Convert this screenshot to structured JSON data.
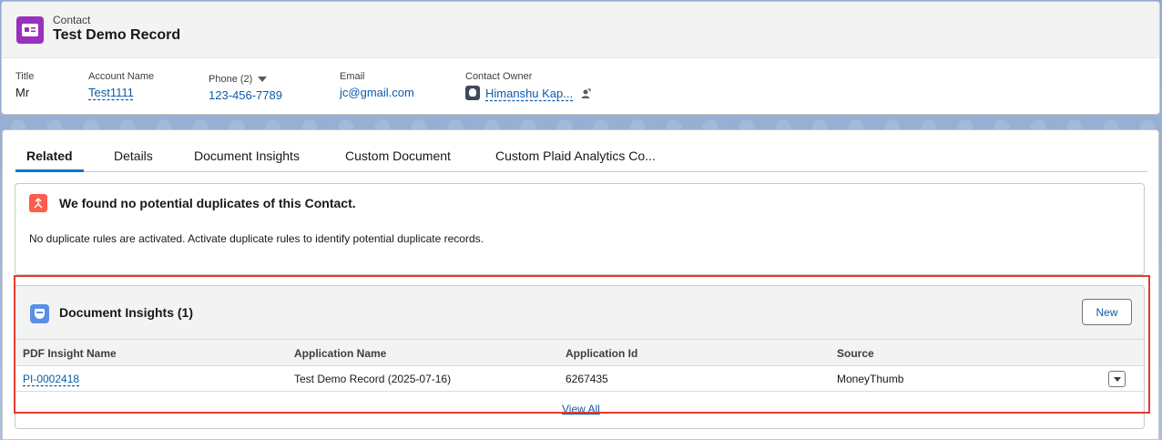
{
  "header": {
    "object_label": "Contact",
    "record_title": "Test Demo Record",
    "icon": "contact-card-icon"
  },
  "highlights": {
    "title": {
      "label": "Title",
      "value": "Mr"
    },
    "account_name": {
      "label": "Account Name",
      "value": "Test1111"
    },
    "phone": {
      "label": "Phone (2)",
      "value": "123-456-7789"
    },
    "email": {
      "label": "Email",
      "value": "jc@gmail.com"
    },
    "owner": {
      "label": "Contact Owner",
      "value": "Himanshu Kap..."
    }
  },
  "tabs": [
    {
      "label": "Related",
      "active": true
    },
    {
      "label": "Details"
    },
    {
      "label": "Document Insights"
    },
    {
      "label": "Custom Document"
    },
    {
      "label": "Custom Plaid Analytics Co..."
    }
  ],
  "duplicates": {
    "title": "We found no potential duplicates of this Contact.",
    "message": "No duplicate rules are activated. Activate duplicate rules to identify potential duplicate records."
  },
  "document_insights": {
    "title": "Document Insights (1)",
    "new_label": "New",
    "columns": [
      "PDF Insight Name",
      "Application Name",
      "Application Id",
      "Source"
    ],
    "rows": [
      {
        "name": "PI-0002418",
        "application_name": "Test Demo Record (2025-07-16)",
        "application_id": "6267435",
        "source": "MoneyThumb"
      }
    ],
    "view_all": "View All"
  },
  "colors": {
    "contact_icon": "#9a2fbd",
    "duplicate_icon": "#fe5c4c",
    "insight_icon": "#5a8fe8",
    "link": "#0b5cab",
    "active_tab": "#0176d3",
    "highlight_box": "#e53b2e"
  }
}
